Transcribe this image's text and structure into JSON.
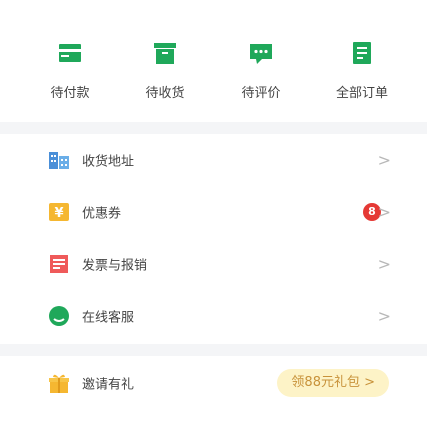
{
  "colors": {
    "accent_green": "#1fa85a",
    "badge_red": "#e53935",
    "pill_bg": "#fdf3c7",
    "pill_text": "#c8923a"
  },
  "orders": [
    {
      "label": "待付款",
      "icon": "wallet-icon"
    },
    {
      "label": "待收货",
      "icon": "package-box-icon"
    },
    {
      "label": "待评价",
      "icon": "comment-bubble-icon"
    },
    {
      "label": "全部订单",
      "icon": "order-list-icon"
    }
  ],
  "menu": [
    {
      "label": "收货地址",
      "icon": "address-building-icon",
      "chevron": ">"
    },
    {
      "label": "优惠券",
      "icon": "coupon-yen-icon",
      "badge": "8",
      "chevron": ">"
    },
    {
      "label": "发票与报销",
      "icon": "invoice-icon",
      "chevron": ">"
    },
    {
      "label": "在线客服",
      "icon": "customer-service-chat-icon",
      "chevron": ">"
    }
  ],
  "gift": {
    "label": "邀请有礼",
    "icon": "gift-icon",
    "cta": "领88元礼包 >"
  }
}
